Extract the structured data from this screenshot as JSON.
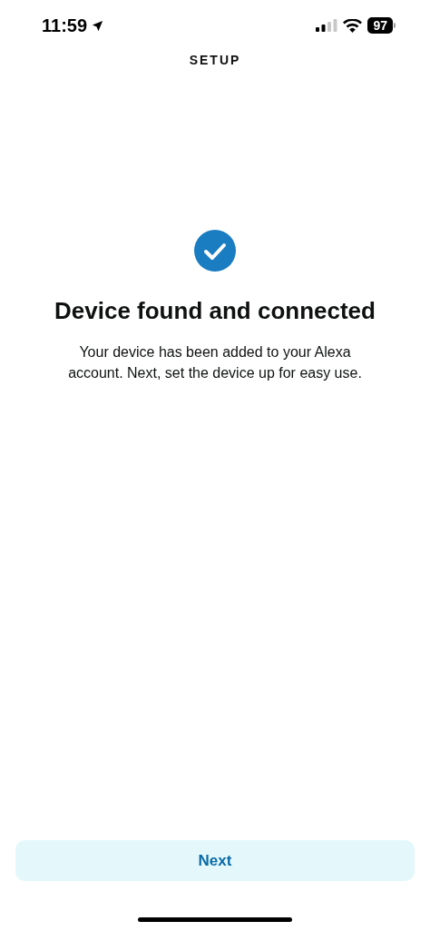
{
  "status_bar": {
    "time": "11:59",
    "battery": "97"
  },
  "header": {
    "title": "SETUP"
  },
  "content": {
    "title": "Device found and connected",
    "body": "Your device has been added to your Alexa account. Next, set the device up for easy use."
  },
  "buttons": [
    {
      "label": "Next"
    }
  ]
}
